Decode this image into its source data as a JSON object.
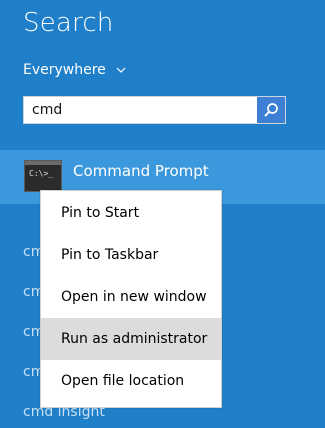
{
  "title": "Search",
  "scope": {
    "label": "Everywhere"
  },
  "search": {
    "value": "cmd"
  },
  "selected_result": {
    "title": "Command Prompt",
    "icon": "command-prompt-icon",
    "icon_text": "C:\\>_"
  },
  "results": [
    {
      "label": "cmd"
    },
    {
      "label": "cmd"
    },
    {
      "label": "cmd"
    },
    {
      "label": "cmd"
    },
    {
      "label": "cmd insight"
    }
  ],
  "context_menu": {
    "items": [
      {
        "label": "Pin to Start"
      },
      {
        "label": "Pin to Taskbar"
      },
      {
        "label": "Open in new window"
      },
      {
        "label": "Run as administrator",
        "highlighted": true
      },
      {
        "label": "Open file location"
      }
    ]
  },
  "colors": {
    "background": "#1f7fc9",
    "selected_row": "#3c98dd",
    "search_button": "#3d7fd4",
    "menu_hover": "#dcdcdc"
  }
}
